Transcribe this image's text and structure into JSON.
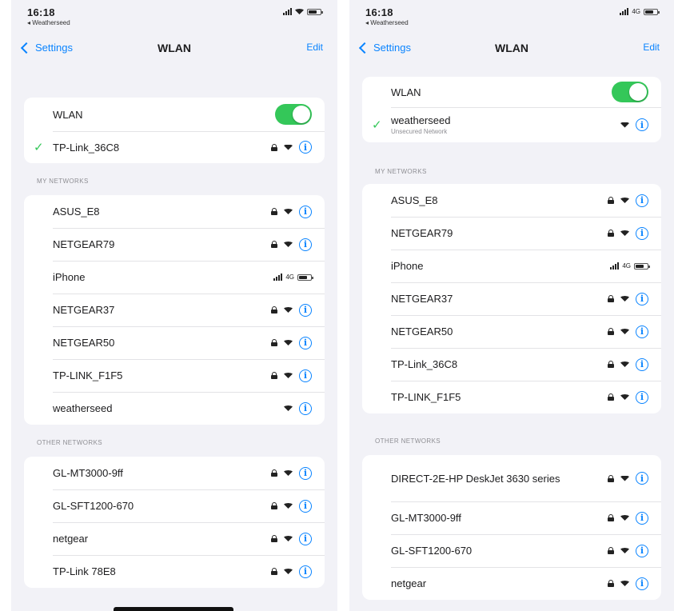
{
  "left": {
    "status": {
      "time": "16:18",
      "back_app": "◂ Weatherseed"
    },
    "nav": {
      "back_label": "Settings",
      "title": "WLAN",
      "edit_label": "Edit"
    },
    "wlan_label": "WLAN",
    "connected": {
      "name": "TP-Link_36C8"
    },
    "my_networks_header": "MY NETWORKS",
    "my_networks": [
      {
        "name": "ASUS_E8",
        "kind": "wifi-locked"
      },
      {
        "name": "NETGEAR79",
        "kind": "wifi-locked"
      },
      {
        "name": "iPhone",
        "kind": "hotspot",
        "cell_label": "4G"
      },
      {
        "name": "NETGEAR37",
        "kind": "wifi-locked"
      },
      {
        "name": "NETGEAR50",
        "kind": "wifi-locked"
      },
      {
        "name": "TP-LINK_F1F5",
        "kind": "wifi-locked"
      },
      {
        "name": "weatherseed",
        "kind": "wifi-open"
      }
    ],
    "other_networks_header": "OTHER NETWORKS",
    "other_networks": [
      {
        "name": "GL-MT3000-9ff",
        "kind": "wifi-locked"
      },
      {
        "name": "GL-SFT1200-670",
        "kind": "wifi-locked"
      },
      {
        "name": "netgear",
        "kind": "wifi-locked"
      },
      {
        "name": "TP-Link 78E8",
        "kind": "wifi-locked"
      }
    ]
  },
  "right": {
    "status": {
      "time": "16:18",
      "back_app": "◂ Weatherseed",
      "cell_label": "4G"
    },
    "nav": {
      "back_label": "Settings",
      "title": "WLAN",
      "edit_label": "Edit"
    },
    "wlan_label": "WLAN",
    "connected": {
      "name": "weatherseed",
      "subtitle": "Unsecured Network"
    },
    "my_networks_header": "MY NETWORKS",
    "my_networks": [
      {
        "name": "ASUS_E8",
        "kind": "wifi-locked"
      },
      {
        "name": "NETGEAR79",
        "kind": "wifi-locked"
      },
      {
        "name": "iPhone",
        "kind": "hotspot",
        "cell_label": "4G"
      },
      {
        "name": "NETGEAR37",
        "kind": "wifi-locked"
      },
      {
        "name": "NETGEAR50",
        "kind": "wifi-locked"
      },
      {
        "name": "TP-Link_36C8",
        "kind": "wifi-locked"
      },
      {
        "name": "TP-LINK_F1F5",
        "kind": "wifi-locked"
      }
    ],
    "other_networks_header": "OTHER NETWORKS",
    "other_networks": [
      {
        "name": "DIRECT-2E-HP DeskJet 3630 series",
        "kind": "wifi-locked"
      },
      {
        "name": "GL-MT3000-9ff",
        "kind": "wifi-locked"
      },
      {
        "name": "GL-SFT1200-670",
        "kind": "wifi-locked"
      },
      {
        "name": "netgear",
        "kind": "wifi-locked"
      }
    ]
  },
  "colors": {
    "accent": "#0a84ff",
    "toggle_on": "#34c759",
    "background": "#f2f2f7"
  }
}
